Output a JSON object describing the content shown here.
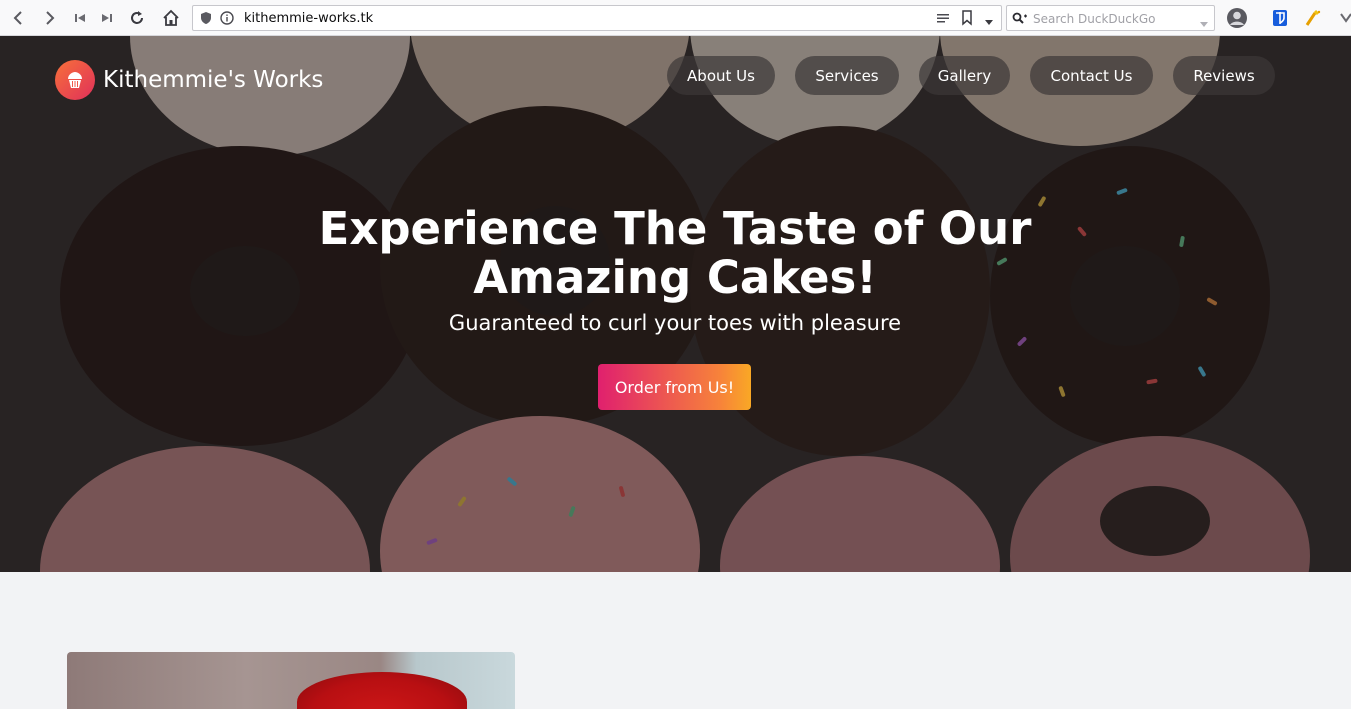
{
  "browser": {
    "url": "kithemmie-works.tk",
    "search_placeholder": "Search DuckDuckGo"
  },
  "site": {
    "brand_name": "Kithemmie's Works",
    "nav": [
      {
        "label": "About Us"
      },
      {
        "label": "Services"
      },
      {
        "label": "Gallery"
      },
      {
        "label": "Contact Us"
      },
      {
        "label": "Reviews"
      }
    ],
    "hero": {
      "title_line1": "Experience The Taste of Our",
      "title_line2": "Amazing Cakes!",
      "subtitle": "Guaranteed to curl your toes with pleasure",
      "cta_label": "Order from Us!"
    }
  },
  "colors": {
    "accent_start": "#e0206e",
    "accent_end": "#f9a825",
    "hero_overlay": "rgba(20,16,16,0.45)",
    "section_bg": "#f2f3f5"
  }
}
